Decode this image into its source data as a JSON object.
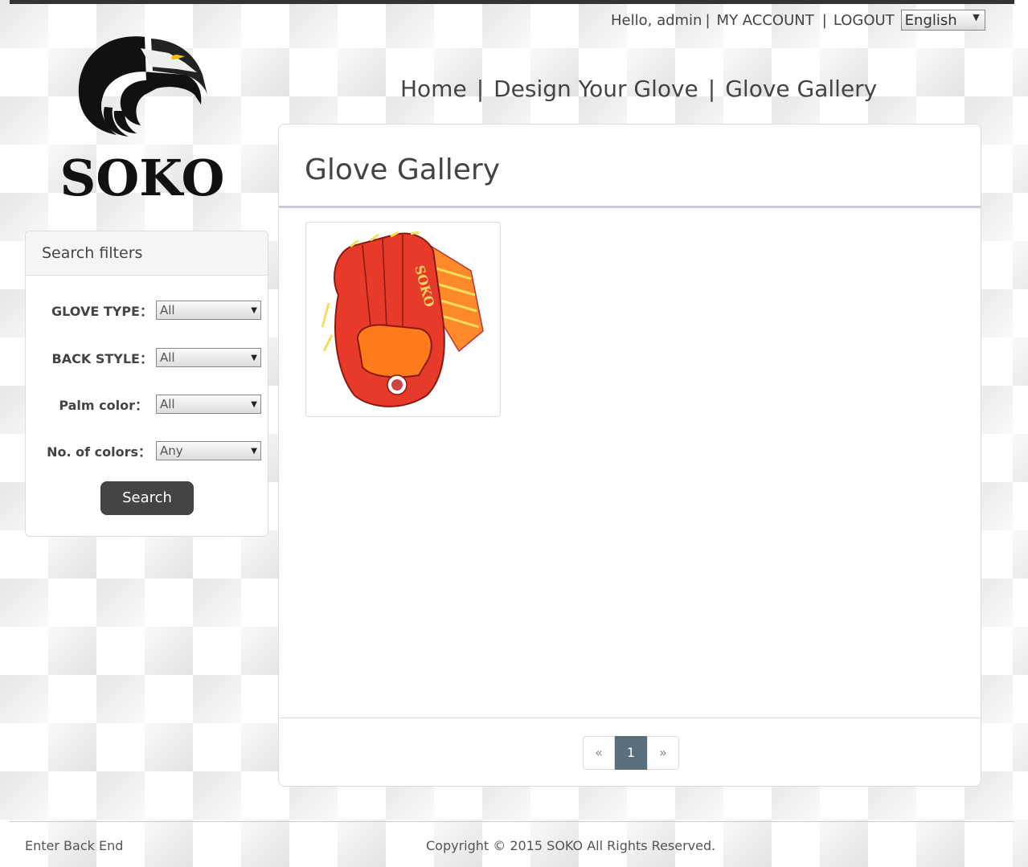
{
  "header": {
    "greeting": "Hello, admin",
    "separator": "|",
    "my_account": "MY ACCOUNT",
    "logout": "LOGOUT",
    "language": "English"
  },
  "logo": {
    "text": "SOKO"
  },
  "nav": {
    "home": "Home",
    "design": "Design Your Glove",
    "gallery": "Glove Gallery",
    "separator": "|"
  },
  "filters": {
    "title": "Search filters",
    "glove_type": {
      "label": "GLOVE TYPE：",
      "value": "All"
    },
    "back_style": {
      "label": "BACK STYLE：",
      "value": "All"
    },
    "palm_color": {
      "label": "Palm color：",
      "value": "All"
    },
    "num_colors": {
      "label": "No. of colors：",
      "value": "Any"
    },
    "search_label": "Search"
  },
  "main": {
    "title": "Glove Gallery"
  },
  "pagination": {
    "prev": "«",
    "current": "1",
    "next": "»"
  },
  "footer": {
    "back_end": "Enter Back End",
    "copyright": "Copyright © 2015 SOKO All Rights Reserved."
  },
  "colors": {
    "accent": "#444444",
    "pager_active": "#5a6e7b",
    "glove_red": "#e83a2a",
    "glove_orange": "#ff7a1a",
    "lace_yellow": "#f2e05a"
  }
}
